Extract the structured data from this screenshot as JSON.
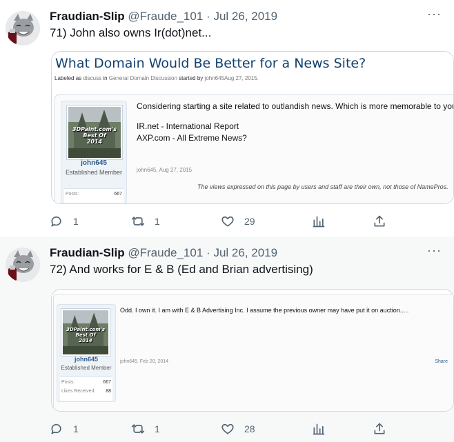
{
  "tweets": [
    {
      "display_name": "Fraudian-Slip",
      "handle": "@Fraude_101",
      "separator": "·",
      "date": "Jul 26, 2019",
      "more": "···",
      "text": "71) John also owns Ir(dot)net...",
      "embed": {
        "title": "What Domain Would Be Better for a News Site?",
        "meta": {
          "labeled_as": "Labeled as",
          "tag": "discuss",
          "in_word": "in",
          "forum": "General Domain Discussion",
          "started_by": "started by",
          "author": "john645",
          "date": "Aug 27, 2015."
        },
        "user": {
          "badge_line1": "3DPaint.com's",
          "badge_line2": "Best Of",
          "badge_line3": "2014",
          "name": "john645",
          "role": "Established Member",
          "stats": [
            {
              "label": "Posts:",
              "value": "667"
            }
          ]
        },
        "post_lines": [
          "Considering starting a site related to outlandish news. Which is more memorable to you?",
          "",
          "IR.net - International Report",
          "AXP.com - All Extreme News?"
        ],
        "signature": "john645, Aug 27, 2015",
        "disclaimer": "The views expressed on this page by users and staff are their own, not those of NamePros."
      },
      "actions": {
        "replies": "1",
        "retweets": "1",
        "likes": "29"
      }
    },
    {
      "display_name": "Fraudian-Slip",
      "handle": "@Fraude_101",
      "separator": "·",
      "date": "Jul 26, 2019",
      "more": "···",
      "text": "72) And works for E & B (Ed and Brian advertising)",
      "embed": {
        "user": {
          "badge_line1": "3DPaint.com's",
          "badge_line2": "Best Of",
          "badge_line3": "2014",
          "name": "john645",
          "role": "Established Member",
          "stats": [
            {
              "label": "Posts:",
              "value": "667"
            },
            {
              "label": "Likes Received:",
              "value": "88"
            }
          ]
        },
        "post_text": "Odd. I own it. I am with E & B Advertising Inc. I assume the previous owner may have put it on auction.....",
        "signature": "john645, Feb 20, 2014",
        "share": "Share"
      },
      "actions": {
        "replies": "1",
        "retweets": "1",
        "likes": "28"
      }
    }
  ]
}
